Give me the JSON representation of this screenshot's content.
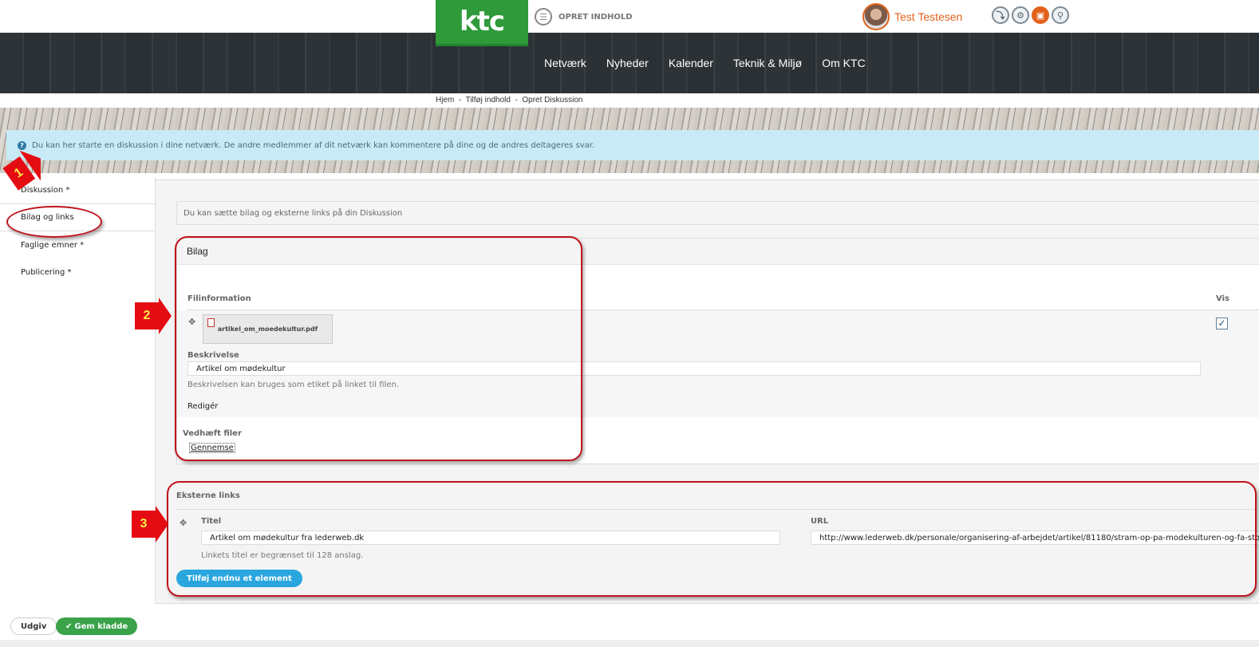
{
  "header": {
    "logo_text": "ktc",
    "create_label": "OPRET INDHOLD",
    "user_name": "Test Testesen",
    "tools": [
      "download-icon",
      "gear-icon",
      "lock-icon",
      "search-icon"
    ]
  },
  "nav": {
    "items": [
      "Netværk",
      "Nyheder",
      "Kalender",
      "Teknik & Miljø",
      "Om KTC"
    ]
  },
  "breadcrumb": {
    "text": "Hjem  -  Tilføj indhold  -  Opret Diskussion"
  },
  "info_banner": {
    "text": "Du kan her starte en diskussion i dine netværk. De andre medlemmer af dit netværk kan kommentere på dine og de andres deltageres svar."
  },
  "sidebar": {
    "items": [
      {
        "label": "Diskussion *"
      },
      {
        "label": "Bilag og links"
      },
      {
        "label": "Faglige emner *"
      },
      {
        "label": "Publicering *"
      }
    ]
  },
  "main": {
    "help_text": "Du kan sætte bilag og eksterne links på din Diskussion",
    "bilag": {
      "title": "Bilag",
      "col_file": "Filinformation",
      "col_vis": "Vis",
      "file_name": "artikel_om_moedekultur.pdf",
      "vis_checked": true,
      "desc_label": "Beskrivelse",
      "desc_value": "Artikel om mødekultur",
      "desc_hint": "Beskrivelsen kan bruges som etiket på linket til filen.",
      "edit_label": "Redigér",
      "attach_label": "Vedhæft filer",
      "browse_label": "Gennemse"
    },
    "links": {
      "title": "Eksterne links",
      "title_label": "Titel",
      "url_label": "URL",
      "title_value": "Artikel om mødekultur fra lederweb.dk",
      "url_value": "http://www.lederweb.dk/personale/organisering-af-arbejdet/artikel/81180/stram-op-pa-modekulturen-og-fa-storre-effekt",
      "title_hint": "Linkets titel er begrænset til 128 anslag.",
      "add_label": "Tilføj endnu et element"
    }
  },
  "footer": {
    "publish_label": "Udgiv",
    "draft_label": "Gem kladde"
  },
  "annotations": {
    "markers": [
      "1",
      "2",
      "3"
    ],
    "color": "#e40b12"
  }
}
